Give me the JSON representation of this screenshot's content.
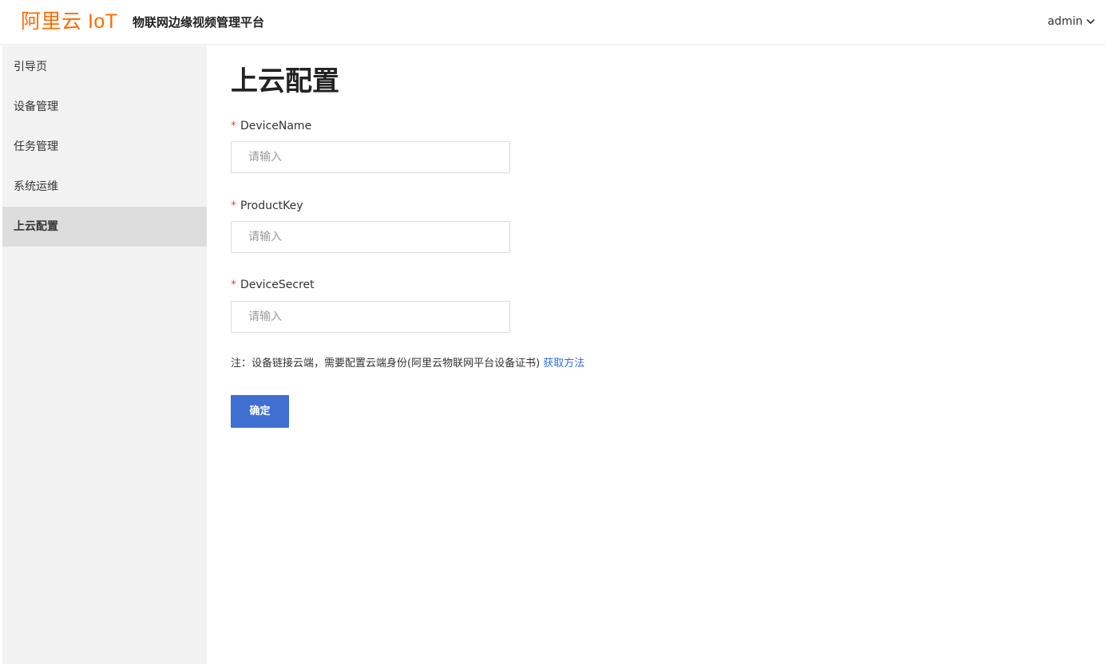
{
  "header": {
    "brand": "阿里云 IoT",
    "app_title": "物联网边缘视频管理平台",
    "user": "admin",
    "user_menu_icon": "chevron-down-icon"
  },
  "sidebar": {
    "items": [
      {
        "label": "引导页",
        "active": false
      },
      {
        "label": "设备管理",
        "active": false
      },
      {
        "label": "任务管理",
        "active": false
      },
      {
        "label": "系统运维",
        "active": false
      },
      {
        "label": "上云配置",
        "active": true
      }
    ]
  },
  "main": {
    "title": "上云配置",
    "required_mark": "*",
    "fields": [
      {
        "label": "DeviceName",
        "value": "",
        "placeholder": "请输入"
      },
      {
        "label": "ProductKey",
        "value": "",
        "placeholder": "请输入"
      },
      {
        "label": "DeviceSecret",
        "value": "",
        "placeholder": "请输入"
      }
    ],
    "note_text": "注：设备链接云端，需要配置云端身份(阿里云物联网平台设备证书)",
    "note_link": "获取方法",
    "submit_label": "确定"
  },
  "colors": {
    "brand": "#ff6a00",
    "primary": "#3f6fd0",
    "link": "#2f6fdc",
    "required": "#e64b3c",
    "sidebar_bg": "#f2f2f2",
    "sidebar_active_bg": "#dddddd"
  }
}
